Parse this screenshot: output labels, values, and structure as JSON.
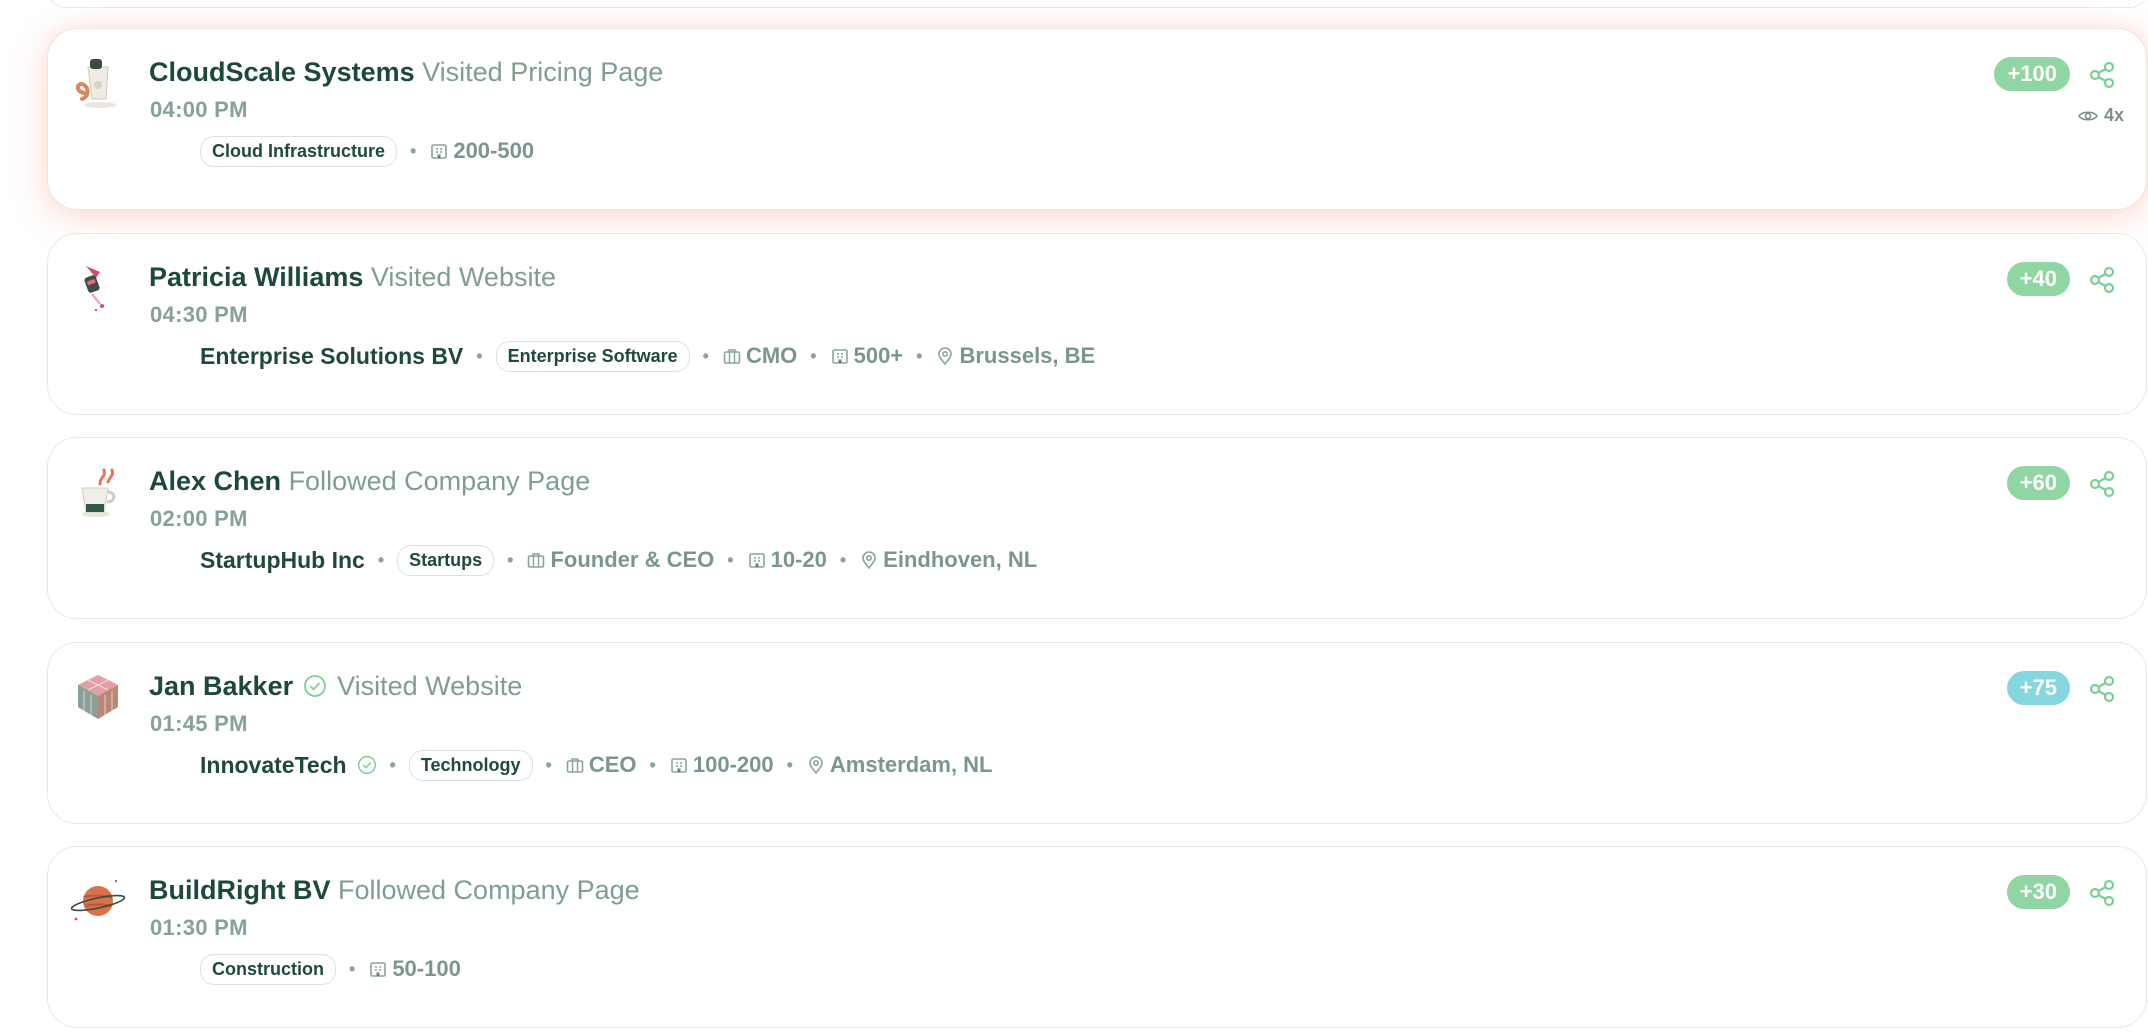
{
  "colors": {
    "name": "#1d4a36",
    "action": "#7f9e8e",
    "badge_green": "#8fd6a3",
    "badge_teal": "#86d6df",
    "share_icon": "#7ccf95",
    "verify_icon": "#7ccf95"
  },
  "events": [
    {
      "avatar_icon": "coffee-cup-icon",
      "name": "CloudScale Systems",
      "action": "Visited Pricing Page",
      "time": "04:00 PM",
      "company": "",
      "industry": "Cloud Infrastructure",
      "role": "",
      "size": "200-500",
      "location": "",
      "score": "+100",
      "views": "4x",
      "highlighted": true
    },
    {
      "avatar_icon": "rocket-icon",
      "name": "Patricia Williams",
      "action": "Visited Website",
      "time": "04:30 PM",
      "company": "Enterprise Solutions BV",
      "industry": "Enterprise Software",
      "role": "CMO",
      "size": "500+",
      "location": "Brussels, BE",
      "score": "+40"
    },
    {
      "avatar_icon": "mug-icon",
      "name": "Alex Chen",
      "action": "Followed Company Page",
      "time": "02:00 PM",
      "company": "StartupHub Inc",
      "industry": "Startups",
      "role": "Founder & CEO",
      "size": "10-20",
      "location": "Eindhoven, NL",
      "score": "+60"
    },
    {
      "avatar_icon": "cube-icon",
      "name": "Jan Bakker",
      "action": "Visited Website",
      "time": "01:45 PM",
      "company": "InnovateTech",
      "industry": "Technology",
      "role": "CEO",
      "size": "100-200",
      "location": "Amsterdam, NL",
      "score": "+75",
      "verified": true
    },
    {
      "avatar_icon": "planet-icon",
      "name": "BuildRight BV",
      "action": "Followed Company Page",
      "time": "01:30 PM",
      "company": "",
      "industry": "Construction",
      "role": "",
      "size": "50-100",
      "location": "",
      "score": "+30"
    }
  ]
}
